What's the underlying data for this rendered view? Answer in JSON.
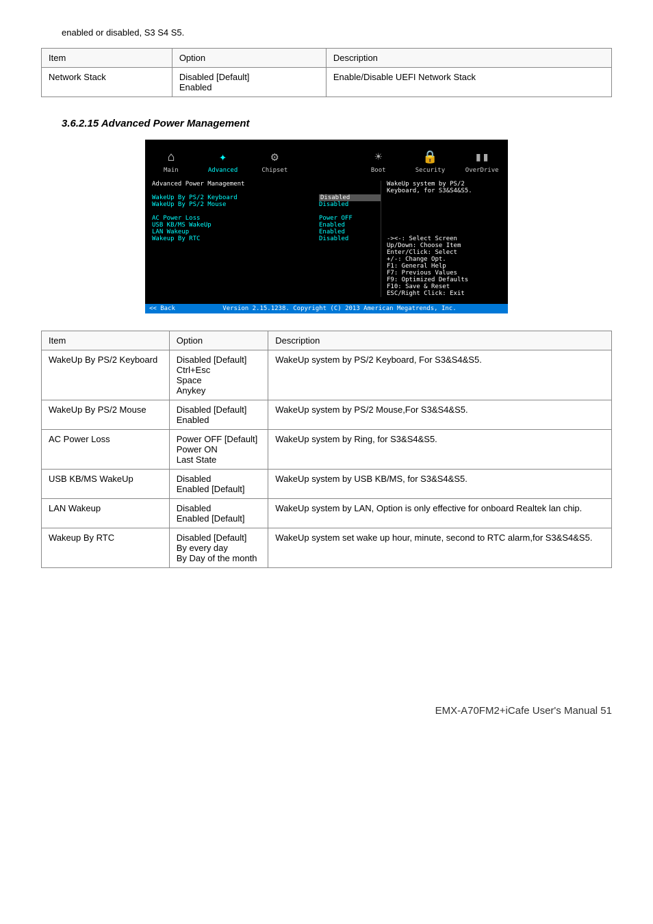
{
  "top_text": "enabled or disabled, S3 S4 S5.",
  "table1": {
    "headers": [
      "Item",
      "Option",
      "Description"
    ],
    "rows": [
      [
        "Network Stack",
        "Disabled [Default]\nEnabled",
        "Enable/Disable UEFI Network Stack"
      ]
    ]
  },
  "section_title": "3.6.2.15 Advanced Power Management",
  "bios": {
    "tabs": [
      "Main",
      "Advanced",
      "Chipset",
      "",
      "Boot",
      "Security",
      "OverDrive"
    ],
    "active_tab": 1,
    "header": "Advanced Power Management",
    "items": [
      {
        "label": "WakeUp By PS/2 Keyboard",
        "value": "Disabled",
        "selected": true
      },
      {
        "label": "WakeUp By PS/2 Mouse",
        "value": "Disabled"
      },
      {
        "label": "",
        "value": ""
      },
      {
        "label": "AC Power Loss",
        "value": "Power OFF"
      },
      {
        "label": "USB KB/MS WakeUp",
        "value": "Enabled"
      },
      {
        "label": "LAN Wakeup",
        "value": "Enabled"
      },
      {
        "label": "Wakeup By RTC",
        "value": "Disabled"
      }
    ],
    "desc": "WakeUp system by PS/2 Keyboard, for S3&S4&S5.",
    "help": "-><-: Select Screen\nUp/Down: Choose Item\nEnter/Click: Select\n+/-: Change Opt.\nF1:  General Help\nF7:  Previous Values\nF9:  Optimized Defaults\nF10: Save & Reset\nESC/Right Click: Exit",
    "back": "<< Back",
    "copyright": "Version 2.15.1238. Copyright (C) 2013 American Megatrends, Inc."
  },
  "table2": {
    "headers": [
      "Item",
      "Option",
      "Description"
    ],
    "rows": [
      [
        "WakeUp By PS/2 Keyboard",
        "Disabled [Default]\nCtrl+Esc\nSpace\nAnykey",
        "WakeUp system by PS/2 Keyboard, For S3&S4&S5."
      ],
      [
        "WakeUp By PS/2 Mouse",
        "Disabled [Default]\nEnabled",
        "WakeUp system by PS/2 Mouse,For S3&S4&S5."
      ],
      [
        "AC Power Loss",
        "Power OFF [Default]\nPower ON\nLast State",
        "WakeUp system by Ring, for S3&S4&S5."
      ],
      [
        "USB KB/MS WakeUp",
        "Disabled\nEnabled [Default]",
        "WakeUp system by USB KB/MS, for S3&S4&S5."
      ],
      [
        "LAN Wakeup",
        "Disabled\nEnabled [Default]",
        "WakeUp system by LAN, Option is only effective for onboard Realtek lan chip."
      ],
      [
        "Wakeup By RTC",
        "Disabled [Default]\nBy every day\nBy Day of the month",
        "WakeUp system set wake up hour, minute, second to RTC alarm,for S3&S4&S5."
      ]
    ]
  },
  "footer": "EMX-A70FM2+iCafe User's Manual   51"
}
